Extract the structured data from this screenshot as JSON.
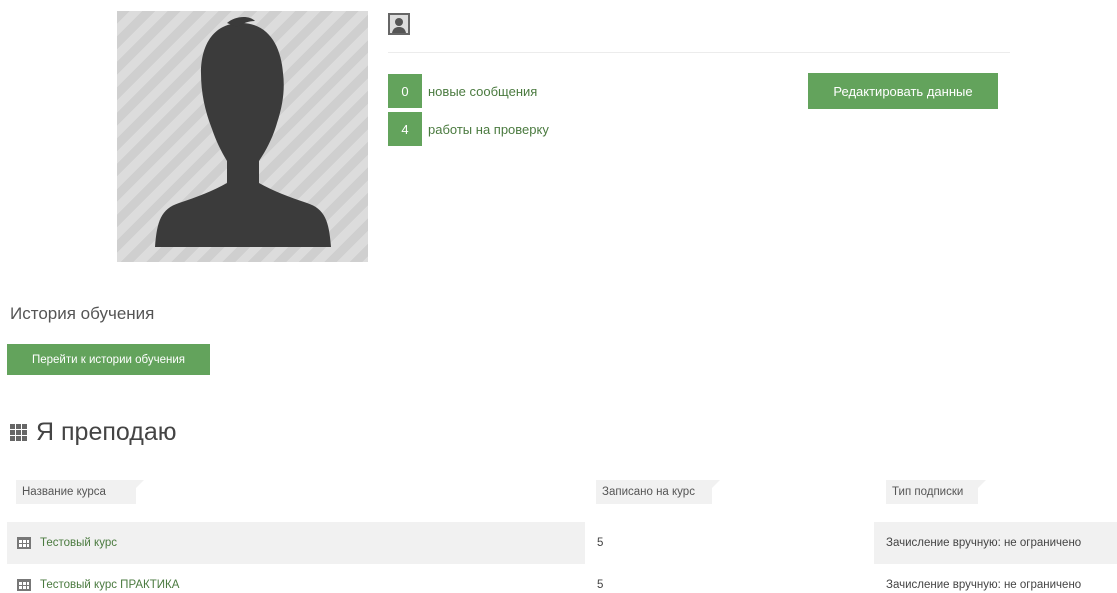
{
  "profile": {
    "stats": [
      {
        "count": "0",
        "label": "новые сообщения"
      },
      {
        "count": "4",
        "label": "работы на проверку"
      }
    ],
    "edit_button": "Редактировать данные"
  },
  "history": {
    "title": "История обучения",
    "button": "Перейти к истории обучения"
  },
  "teaching": {
    "title": "Я преподаю",
    "columns": [
      "Название курса",
      "Записано на курс",
      "Тип подписки"
    ],
    "rows": [
      {
        "name": "Тестовый курс",
        "enrolled": "5",
        "subscription": "Зачисление вручную: не ограничено"
      },
      {
        "name": "Тестовый курс ПРАКТИКА",
        "enrolled": "5",
        "subscription": "Зачисление вручную: не ограничено"
      }
    ]
  },
  "colors": {
    "accent": "#63a35c",
    "link": "#4a7a3f",
    "header_bg": "#f1f1f1"
  },
  "icons": [
    "user-avatar-placeholder",
    "user-icon",
    "grid-icon",
    "course-table-icon"
  ]
}
